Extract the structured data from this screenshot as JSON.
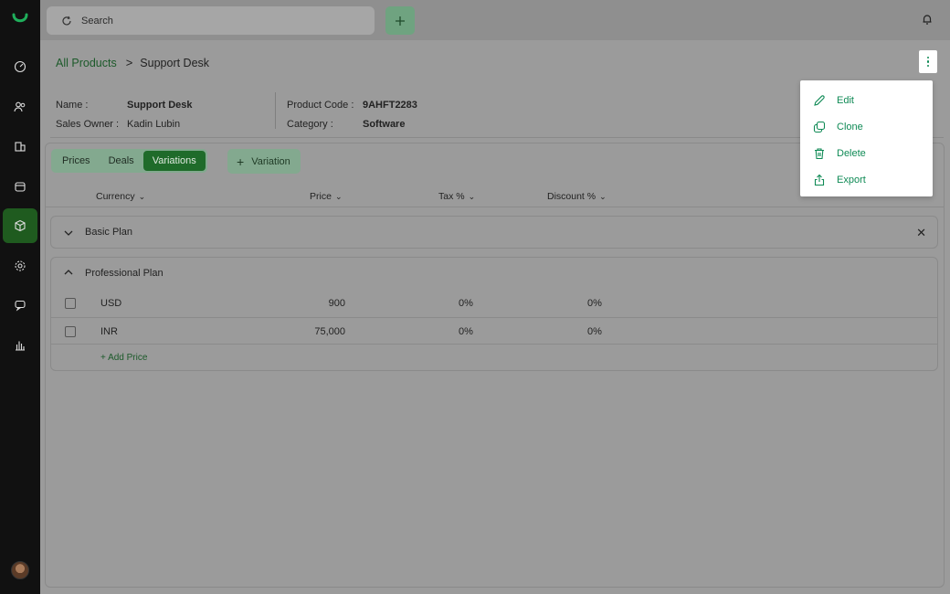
{
  "search": {
    "label": "Search"
  },
  "breadcrumb": {
    "parent": "All Products",
    "separator": ">",
    "current": "Support Desk"
  },
  "info": {
    "name_label": "Name :",
    "name_value": "Support Desk",
    "owner_label": "Sales Owner :",
    "owner_value": "Kadin Lubin",
    "code_label": "Product Code :",
    "code_value": "9AHFT2283",
    "category_label": "Category :",
    "category_value": "Software"
  },
  "tabs": [
    "Prices",
    "Deals",
    "Variations"
  ],
  "variation_button": {
    "label": "Variation"
  },
  "columns": [
    "Currency",
    "Price",
    "Tax %",
    "Discount %"
  ],
  "plans": {
    "basic": {
      "title": "Basic Plan"
    },
    "pro": {
      "title": "Professional Plan",
      "rows": [
        {
          "currency": "USD",
          "price": "900",
          "tax": "0%",
          "discount": "0%"
        },
        {
          "currency": "INR",
          "price": "75,000",
          "tax": "0%",
          "discount": "0%"
        }
      ],
      "add_price": "+ Add Price"
    }
  },
  "menu": {
    "items": [
      "Edit",
      "Clone",
      "Delete",
      "Export"
    ]
  },
  "colors": {
    "accent": "#0f8a55",
    "active_tab": "#1f6b2a",
    "link": "#1c5a2a"
  }
}
